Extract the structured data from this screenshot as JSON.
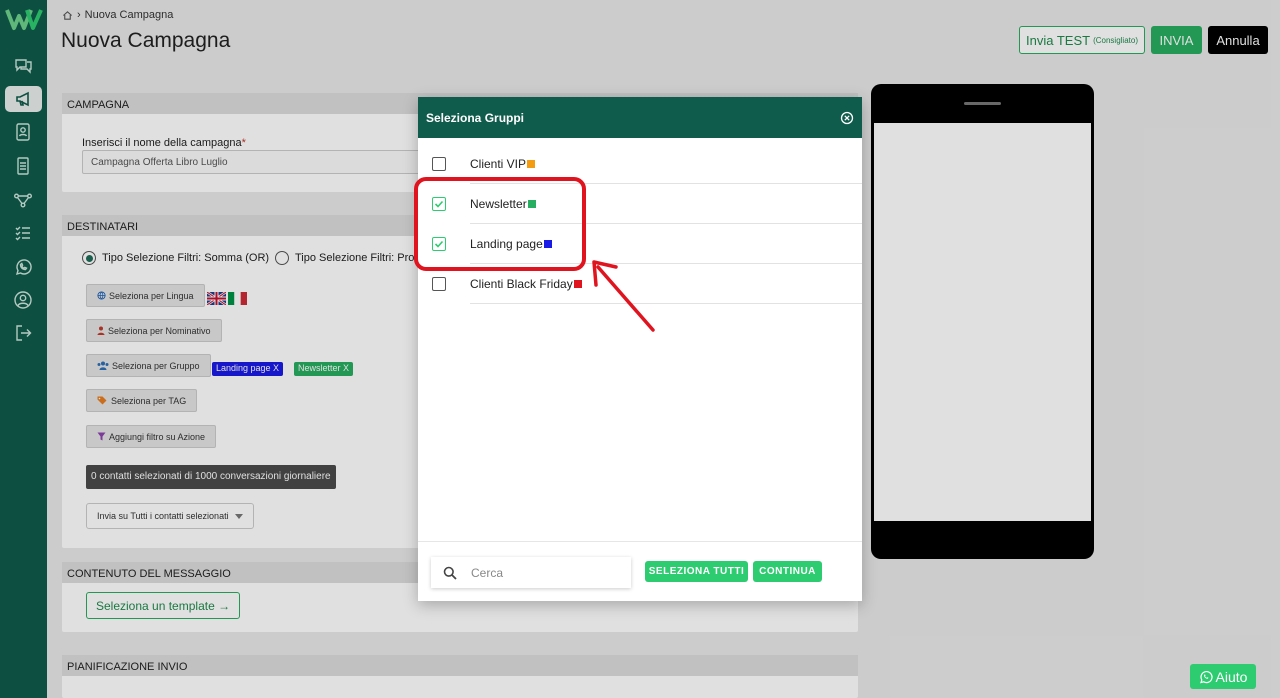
{
  "breadcrumb": {
    "home_icon": "home-icon",
    "current": "Nuova Campagna"
  },
  "page": {
    "title": "Nuova Campagna"
  },
  "header_buttons": {
    "test_label": "Invia TEST",
    "test_hint": "(Consigliato)",
    "send_label": "INVIA",
    "cancel_label": "Annulla"
  },
  "sidebar": {
    "items": [
      {
        "icon": "chat-icon"
      },
      {
        "icon": "megaphone-icon",
        "active": true
      },
      {
        "icon": "contacts-icon"
      },
      {
        "icon": "document-icon"
      },
      {
        "icon": "flow-icon"
      },
      {
        "icon": "checklist-icon"
      },
      {
        "icon": "whatsapp-icon"
      },
      {
        "icon": "user-icon"
      },
      {
        "icon": "logout-icon"
      }
    ]
  },
  "campaign": {
    "section_title": "CAMPAGNA",
    "name_label": "Inserisci il nome della campagna",
    "required_mark": "*",
    "name_value": "Campagna Offerta Libro Luglio"
  },
  "recipients": {
    "section_title": "DESTINATARI",
    "radio_or": "Tipo Selezione Filtri: Somma (OR)",
    "radio_and": "Tipo Selezione Filtri: Prod",
    "btn_language": "Seleziona per Lingua",
    "btn_name": "Seleziona per Nominativo",
    "btn_group": "Seleziona per Gruppo",
    "btn_tag": "Seleziona per TAG",
    "btn_action": "Aggiungi filtro su Azione",
    "tags": [
      {
        "label": "Landing page X",
        "color": "#1a1ae6"
      },
      {
        "label": "Newsletter X",
        "color": "#27ae60"
      }
    ],
    "counter": "0 contatti selezionati di 1000 conversazioni giornaliere",
    "dropdown": "Invia su Tutti i contatti selezionati"
  },
  "content": {
    "section_title": "CONTENUTO DEL MESSAGGIO",
    "template_btn": "Seleziona un template →"
  },
  "schedule": {
    "section_title": "PIANIFICAZIONE INVIO"
  },
  "modal": {
    "title": "Seleziona Gruppi",
    "groups": [
      {
        "name": "Clienti VIP",
        "checked": false,
        "color": "#f39c12"
      },
      {
        "name": "Newsletter",
        "checked": true,
        "color": "#27ae60"
      },
      {
        "name": "Landing page",
        "checked": true,
        "color": "#1a1ae6"
      },
      {
        "name": "Clienti Black Friday",
        "checked": false,
        "color": "#e0141f"
      }
    ],
    "search_placeholder": "Cerca",
    "select_all": "SELEZIONA TUTTI",
    "continue": "CONTINUA"
  },
  "help": {
    "label": "Aiuto"
  },
  "colors": {
    "brand": "#0f5c4c",
    "accent": "#2ecc71",
    "annotation": "#e0141f"
  }
}
